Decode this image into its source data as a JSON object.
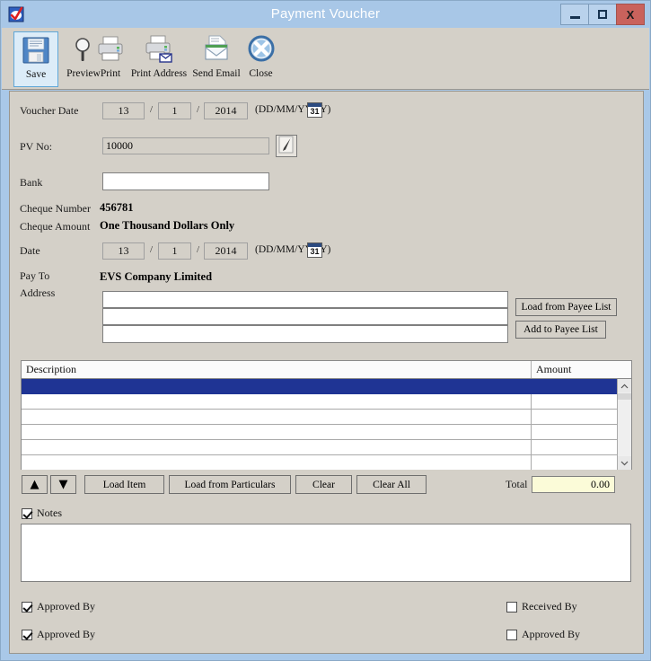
{
  "window": {
    "title": "Payment Voucher",
    "app_icon": "checkmark-app-icon",
    "minimize_label": "–",
    "maximize_label": "□",
    "close_label": "X",
    "titlebar_color": "#a8c7e7",
    "close_button_color": "#c9625c",
    "client_background": "#d4d0c8"
  },
  "toolbar": {
    "items": [
      {
        "label": "Save",
        "icon": "floppy-disk-icon",
        "selected": true
      },
      {
        "label": "Preview",
        "icon": "magnifier-icon",
        "selected": false
      },
      {
        "label": "Print",
        "icon": "printer-icon",
        "selected": false
      },
      {
        "label": "Print Address",
        "icon": "printer-mail-icon",
        "selected": false
      },
      {
        "label": "Send Email",
        "icon": "envelope-icon",
        "selected": false
      },
      {
        "label": "Close",
        "icon": "close-circle-icon",
        "selected": false
      }
    ]
  },
  "form": {
    "voucher_date": {
      "label": "Voucher Date",
      "day": "13",
      "month": "1",
      "year": "2014",
      "separator": "/",
      "format_hint": "(DD/MM/YYYY)",
      "calendar_icon": "calendar-31-icon",
      "calendar_day": "31"
    },
    "pv_no": {
      "label": "PV No:",
      "value": "10000",
      "edit_icon": "pencil-edit-icon"
    },
    "bank": {
      "label": "Bank",
      "value": "",
      "placeholder": ""
    },
    "cheque_number": {
      "label": "Cheque Number",
      "value": "456781"
    },
    "cheque_amount": {
      "label": "Cheque Amount",
      "value": "One Thousand Dollars Only"
    },
    "date": {
      "label": "Date",
      "day": "13",
      "month": "1",
      "year": "2014",
      "separator": "/",
      "format_hint": "(DD/MM/YYYY)",
      "calendar_icon": "calendar-31-icon",
      "calendar_day": "31"
    },
    "pay_to": {
      "label": "Pay To",
      "value": "EVS Company Limited"
    },
    "address": {
      "label": "Address",
      "line1": "",
      "line2": "",
      "line3": ""
    },
    "payee_buttons": {
      "load": "Load from Payee List",
      "add": "Add to Payee List"
    }
  },
  "grid": {
    "columns": [
      "Description",
      "Amount"
    ],
    "rows": [
      {
        "description": "",
        "amount": "",
        "selected": true
      },
      {
        "description": "",
        "amount": "",
        "selected": false
      },
      {
        "description": "",
        "amount": "",
        "selected": false
      },
      {
        "description": "",
        "amount": "",
        "selected": false
      },
      {
        "description": "",
        "amount": "",
        "selected": false
      },
      {
        "description": "",
        "amount": "",
        "selected": false
      }
    ],
    "selected_row_color": "#1f3494",
    "scroll_up_icon": "chevron-up-icon",
    "scroll_down_icon": "chevron-down-icon"
  },
  "grid_toolbar": {
    "move_up_icon": "triangle-up-icon",
    "move_down_icon": "triangle-down-icon",
    "move_up_label": "▲",
    "move_down_label": "▼",
    "load_item": "Load Item",
    "load_from_particulars": "Load from Particulars",
    "clear": "Clear",
    "clear_all": "Clear All",
    "total_label": "Total",
    "total_value": "0.00",
    "total_field_color": "#fbfbd8"
  },
  "notes": {
    "label": "Notes",
    "checked": true,
    "value": ""
  },
  "signatures": {
    "left": [
      {
        "label": "Approved By",
        "checked": true
      },
      {
        "label": "Approved By",
        "checked": true
      }
    ],
    "right": [
      {
        "label": "Received By",
        "checked": false
      },
      {
        "label": "Approved By",
        "checked": false
      }
    ]
  }
}
